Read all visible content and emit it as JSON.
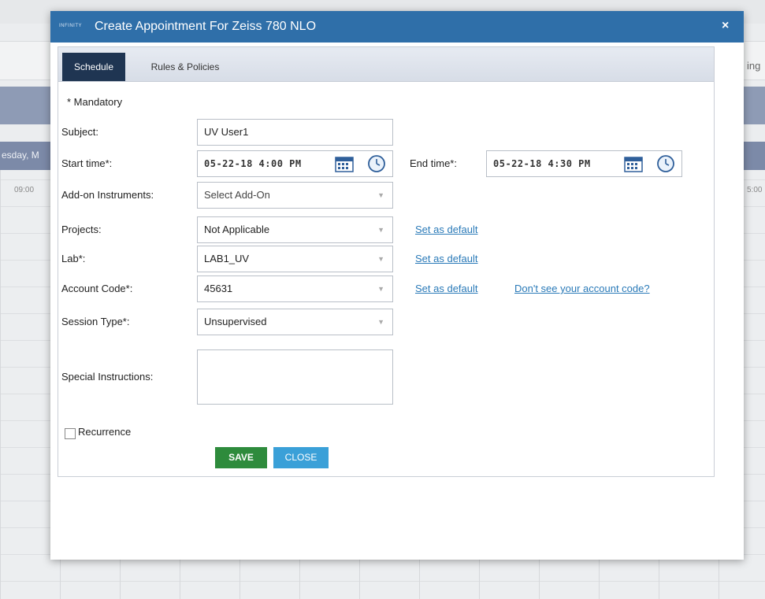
{
  "background": {
    "day_header": "esday, M",
    "time_left": "09:00",
    "time_right": "5:00",
    "right_text": "ing"
  },
  "modal": {
    "brand": "INFINITY",
    "title": "Create Appointment For Zeiss 780 NLO",
    "close_icon": "×",
    "tabs": [
      {
        "label": "Schedule",
        "active": true
      },
      {
        "label": "Rules & Policies",
        "active": false
      }
    ],
    "mandatory_note": "* Mandatory",
    "form": {
      "subject": {
        "label": "Subject:",
        "value": "UV User1"
      },
      "start_time": {
        "label": "Start time*:",
        "value": "05-22-18 4:00 PM",
        "calendar_icon": "calendar-icon",
        "clock_icon": "clock-icon"
      },
      "end_time": {
        "label": "End time*:",
        "value": "05-22-18 4:30 PM",
        "calendar_icon": "calendar-icon",
        "clock_icon": "clock-icon"
      },
      "addon": {
        "label": "Add-on Instruments:",
        "placeholder": "Select Add-On"
      },
      "projects": {
        "label": "Projects:",
        "value": "Not Applicable",
        "link": "Set as default"
      },
      "lab": {
        "label": "Lab*:",
        "value": "LAB1_UV",
        "link": "Set as default"
      },
      "account_code": {
        "label": "Account Code*:",
        "value": "45631",
        "link": "Set as default",
        "help_link": "Don't see your account code?"
      },
      "session_type": {
        "label": "Session Type*:",
        "value": "Unsupervised"
      },
      "special_instructions": {
        "label": "Special Instructions:",
        "value": ""
      },
      "recurrence": {
        "label": "Recurrence",
        "checked": false
      }
    },
    "buttons": {
      "save": "SAVE",
      "close": "CLOSE"
    }
  },
  "colors": {
    "header_blue": "#2f6fa9",
    "tab_active": "#1f3552",
    "save_green": "#2e8b3c",
    "close_blue": "#3aa0d8",
    "link_blue": "#2a7ab8"
  }
}
